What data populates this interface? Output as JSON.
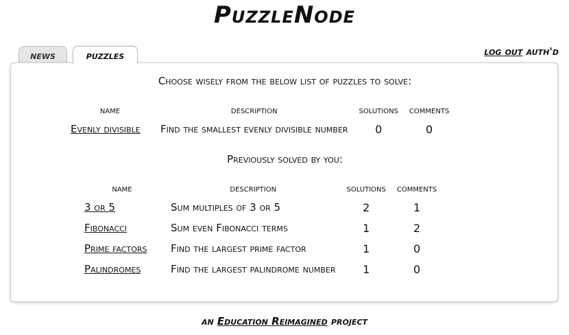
{
  "site": {
    "title": "PuzzleNode"
  },
  "tabs": [
    {
      "label": "news",
      "active": false
    },
    {
      "label": "puzzles",
      "active": true
    }
  ],
  "auth": {
    "logout_label": "log out",
    "status": "auth'd"
  },
  "main": {
    "intro": "Choose wisely from the below list of puzzles to solve:",
    "available": {
      "headers": [
        "name",
        "description",
        "solutions",
        "comments"
      ],
      "rows": [
        {
          "name": "Evenly divisible",
          "description": "Find the smallest evenly divisible number",
          "solutions": "0",
          "comments": "0"
        }
      ]
    },
    "solved_heading": "Previously solved by you:",
    "solved": {
      "headers": [
        "name",
        "description",
        "solutions",
        "comments"
      ],
      "rows": [
        {
          "name": "3 or 5",
          "description": "Sum multiples of 3 or 5",
          "solutions": "2",
          "comments": "1"
        },
        {
          "name": "Fibonacci",
          "description": "Sum even Fibonacci terms",
          "solutions": "1",
          "comments": "2"
        },
        {
          "name": "Prime factors",
          "description": "Find the largest prime factor",
          "solutions": "1",
          "comments": "0"
        },
        {
          "name": "Palindromes",
          "description": "Find the largest palindrome number",
          "solutions": "1",
          "comments": "0"
        }
      ]
    }
  },
  "footer": {
    "prefix": "an",
    "link": "Education Reimagined",
    "suffix": "project"
  }
}
